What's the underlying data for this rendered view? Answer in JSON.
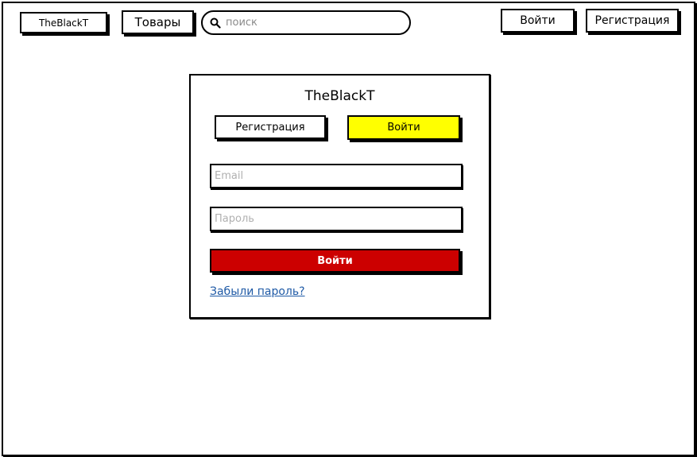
{
  "header": {
    "logo_label": "TheBlackT",
    "products_label": "Товары",
    "search": {
      "placeholder": "поиск",
      "icon": "search-icon"
    },
    "login_label": "Войти",
    "register_label": "Регистрация"
  },
  "login_panel": {
    "title": "TheBlackT",
    "tabs": [
      {
        "label": "Регистрация",
        "active": false
      },
      {
        "label": "Войти",
        "active": true
      }
    ],
    "email_placeholder": "Email",
    "password_placeholder": "Пароль",
    "submit_label": "Войти",
    "forgot_password_label": "Забыли пароль?"
  },
  "colors": {
    "active_tab": "#ffff00",
    "submit_button": "#cc0000",
    "link": "#1f5aa6"
  }
}
